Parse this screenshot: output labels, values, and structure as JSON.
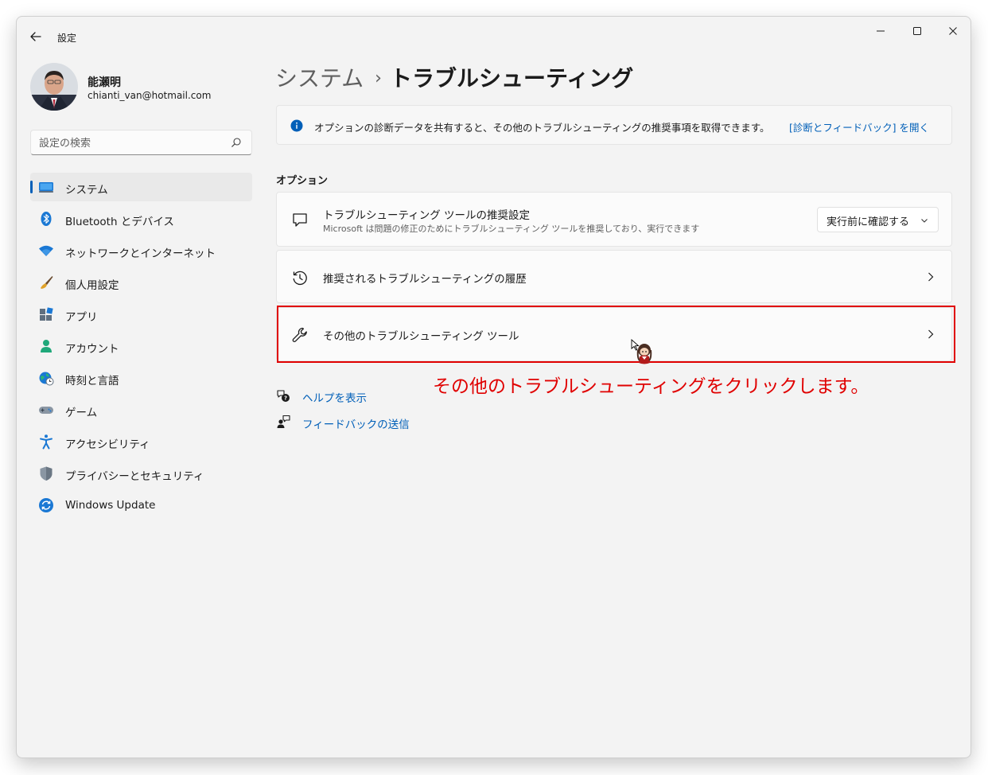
{
  "window": {
    "title": "設定"
  },
  "profile": {
    "name": "能瀬明",
    "email": "chianti_van@hotmail.com"
  },
  "search": {
    "placeholder": "設定の検索"
  },
  "sidebar": {
    "items": [
      {
        "label": "システム",
        "icon": "monitor-icon",
        "active": true
      },
      {
        "label": "Bluetooth とデバイス",
        "icon": "bluetooth-icon"
      },
      {
        "label": "ネットワークとインターネット",
        "icon": "wifi-icon"
      },
      {
        "label": "個人用設定",
        "icon": "brush-icon"
      },
      {
        "label": "アプリ",
        "icon": "apps-icon"
      },
      {
        "label": "アカウント",
        "icon": "person-icon"
      },
      {
        "label": "時刻と言語",
        "icon": "globe-clock-icon"
      },
      {
        "label": "ゲーム",
        "icon": "gamepad-icon"
      },
      {
        "label": "アクセシビリティ",
        "icon": "accessibility-icon"
      },
      {
        "label": "プライバシーとセキュリティ",
        "icon": "shield-icon"
      },
      {
        "label": "Windows Update",
        "icon": "refresh-icon"
      }
    ]
  },
  "breadcrumb": {
    "parent": "システム",
    "separator": "›",
    "current": "トラブルシューティング"
  },
  "info_bar": {
    "text": "オプションの診断データを共有すると、その他のトラブルシューティングの推奨事項を取得できます。",
    "link": "[診断とフィードバック] を開く"
  },
  "options": {
    "section_title": "オプション",
    "recommended_settings": {
      "title": "トラブルシューティング ツールの推奨設定",
      "subtitle": "Microsoft は問題の修正のためにトラブルシューティング ツールを推奨しており、実行できます",
      "dropdown_value": "実行前に確認する"
    },
    "history": {
      "title": "推奨されるトラブルシューティングの履歴"
    },
    "other_tools": {
      "title": "その他のトラブルシューティング ツール"
    }
  },
  "annotation": {
    "text": "その他のトラブルシューティングをクリックします。",
    "color": "#e00000"
  },
  "help": {
    "get_help": "ヘルプを表示",
    "feedback": "フィードバックの送信"
  },
  "colors": {
    "accent": "#005fb8",
    "background": "#f3f3f3",
    "card": "#fbfbfb"
  }
}
